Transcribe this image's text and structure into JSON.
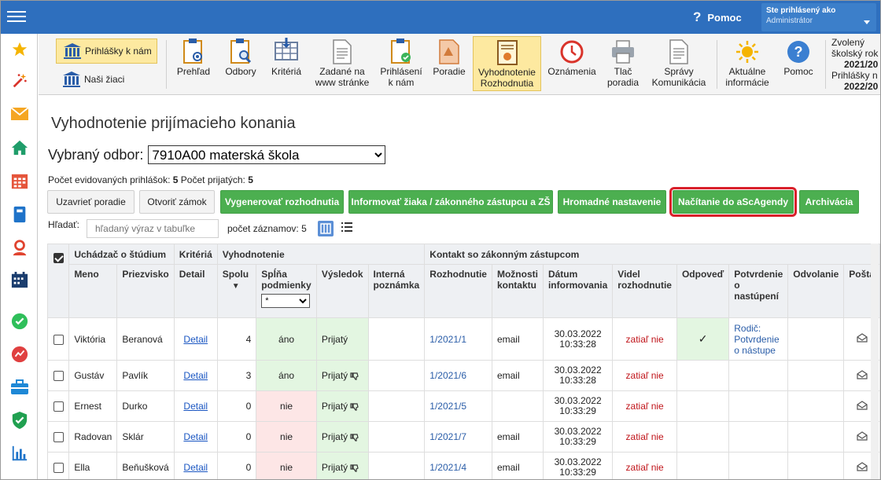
{
  "topbar": {
    "help_label": "Pomoc",
    "user_label": "Ste prihlásený ako",
    "user_role": "Administrátor"
  },
  "sidebar": {
    "icons": [
      "star-icon",
      "wand-icon",
      "mail-icon",
      "home-icon",
      "calendar-grid-icon",
      "book-icon",
      "person-icon",
      "schedule-icon",
      "check-circle-icon",
      "chart-circle-icon",
      "briefcase-icon",
      "shield-icon",
      "bar-chart-icon"
    ]
  },
  "toolbar": {
    "left_buttons": [
      "Prihlášky k nám",
      "Naši žiaci"
    ],
    "items": [
      {
        "label": "Prehľad"
      },
      {
        "label": "Odbory"
      },
      {
        "label": "Kritériá"
      },
      {
        "label": "Zadané na\nwww stránke"
      },
      {
        "label": "Prihlásení\nk nám"
      },
      {
        "label": "Poradie"
      },
      {
        "label": "Vyhodnotenie\nRozhodnutia"
      },
      {
        "label": "Oznámenia"
      },
      {
        "label": "Tlač\nporadia"
      },
      {
        "label": "Správy\nKomunikácia"
      },
      {
        "label": "Aktuálne\ninformácie"
      },
      {
        "label": "Pomoc"
      }
    ],
    "year": {
      "l1": "Zvolený",
      "l2": "školský rok",
      "v1": "2021/20",
      "l3": "Prihlášky n",
      "v2": "2022/20"
    }
  },
  "page": {
    "title": "Vyhodnotenie prijímacieho konania",
    "odbor_label": "Vybraný odbor:",
    "odbor_value": "7910A00 materská škola",
    "counts_text1": "Počet evidovaných prihlášok:",
    "counts_val1": "5",
    "counts_text2": "Počet prijatých:",
    "counts_val2": "5",
    "buttons": [
      "Uzavrieť poradie",
      "Otvoriť zámok",
      "Vygenerovať rozhodnutia",
      "Informovať žiaka / zákonného zástupcu a ZŠ",
      "Hromadné nastavenie",
      "Načítanie do aScAgendy",
      "Archivácia"
    ],
    "search_label": "Hľadať:",
    "search_placeholder": "hľadaný výraz v tabuľke",
    "records_label": "počet záznamov:",
    "records_value": "5"
  },
  "table": {
    "group_headers": {
      "uchadzac": "Uchádzač o štúdium",
      "kriteria": "Kritériá",
      "vyhodnotenie": "Vyhodnotenie",
      "kontakt": "Kontakt so zákonným zástupcom"
    },
    "columns": {
      "meno": "Meno",
      "priezvisko": "Priezvisko",
      "detail": "Detail",
      "spolu": "Spolu",
      "splna": "Spĺňa podmienky",
      "splna_filter": "*",
      "vysledok": "Výsledok",
      "poznamka": "Interná poznámka",
      "rozhodnutie": "Rozhodnutie",
      "moznosti": "Možnosti kontaktu",
      "datum": "Dátum informovania",
      "videl": "Videl rozhodnutie",
      "odpoved": "Odpoveď",
      "potvrdenie": "Potvrdenie o nastúpení",
      "odvolanie": "Odvolanie",
      "posta": "Pošta"
    },
    "rows": [
      {
        "meno": "Viktória",
        "priezvisko": "Beranová",
        "detail": "Detail",
        "spolu": "4",
        "splna": "áno",
        "vysledok": "Prijatý",
        "thumb": false,
        "rozhodnutie": "1/2021/1",
        "kontakt": "email",
        "datum": "30.03.2022",
        "cas": "10:33:28",
        "videl": "zatiaľ nie",
        "odpoved": "✓",
        "potvrdenie": "Rodič: Potvrdenie o nástupe"
      },
      {
        "meno": "Gustáv",
        "priezvisko": "Pavlík",
        "detail": "Detail",
        "spolu": "3",
        "splna": "áno",
        "vysledok": "Prijatý",
        "thumb": true,
        "rozhodnutie": "1/2021/6",
        "kontakt": "email",
        "datum": "30.03.2022",
        "cas": "10:33:28",
        "videl": "zatiaľ nie",
        "odpoved": "",
        "potvrdenie": ""
      },
      {
        "meno": "Ernest",
        "priezvisko": "Durko",
        "detail": "Detail",
        "spolu": "0",
        "splna": "nie",
        "vysledok": "Prijatý",
        "thumb": true,
        "rozhodnutie": "1/2021/5",
        "kontakt": "",
        "datum": "30.03.2022",
        "cas": "10:33:29",
        "videl": "zatiaľ nie",
        "odpoved": "",
        "potvrdenie": ""
      },
      {
        "meno": "Radovan",
        "priezvisko": "Sklár",
        "detail": "Detail",
        "spolu": "0",
        "splna": "nie",
        "vysledok": "Prijatý",
        "thumb": true,
        "rozhodnutie": "1/2021/7",
        "kontakt": "email",
        "datum": "30.03.2022",
        "cas": "10:33:29",
        "videl": "zatiaľ nie",
        "odpoved": "",
        "potvrdenie": ""
      },
      {
        "meno": "Ella",
        "priezvisko": "Beňušková",
        "detail": "Detail",
        "spolu": "0",
        "splna": "nie",
        "vysledok": "Prijatý",
        "thumb": true,
        "rozhodnutie": "1/2021/4",
        "kontakt": "email",
        "datum": "30.03.2022",
        "cas": "10:33:29",
        "videl": "zatiaľ nie",
        "odpoved": "",
        "potvrdenie": ""
      }
    ]
  }
}
